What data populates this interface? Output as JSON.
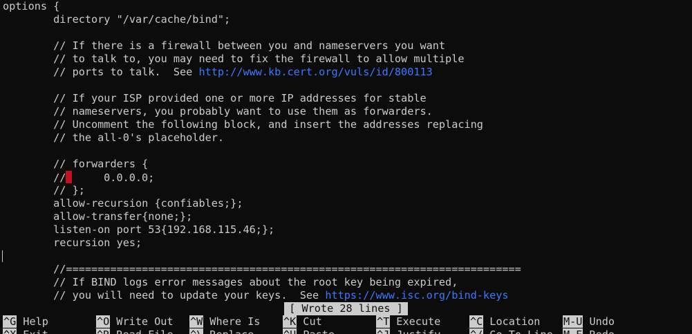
{
  "editor": {
    "lines": [
      "options {",
      "        directory \"/var/cache/bind\";",
      "",
      "        // If there is a firewall between you and nameservers you want",
      "        // to talk to, you may need to fix the firewall to allow multiple",
      "        // ports to talk.  See ",
      "",
      "        // If your ISP provided one or more IP addresses for stable",
      "        // nameservers, you probably want to use them as forwarders.",
      "        // Uncomment the following block, and insert the addresses replacing",
      "        // the all-0's placeholder.",
      "",
      "        // forwarders {",
      "        //",
      "        // };",
      "        allow-recursion {confiables;};",
      "        allow-transfer{none;};",
      "        listen-on port 53{192.168.115.46;};",
      "        recursion yes;",
      "",
      "        //========================================================================",
      "        // If BIND logs error messages about the root key being expired,",
      "        // you will need to update your keys.  See "
    ],
    "url_line_6": "http://www.kb.cert.org/vuls/id/800113",
    "url_line_23": "https://www.isc.org/bind-keys",
    "forwarders_value": "     0.0.0.0;"
  },
  "status": {
    "message": "[ Wrote 28 lines ]"
  },
  "shortcuts": {
    "row1": [
      {
        "key": "^G",
        "label": "Help"
      },
      {
        "key": "^O",
        "label": "Write Out"
      },
      {
        "key": "^W",
        "label": "Where Is"
      },
      {
        "key": "^K",
        "label": "Cut"
      },
      {
        "key": "^T",
        "label": "Execute"
      },
      {
        "key": "^C",
        "label": "Location"
      },
      {
        "key": "M-U",
        "label": "Undo"
      }
    ],
    "row2": [
      {
        "key": "^X",
        "label": "Exit"
      },
      {
        "key": "^R",
        "label": "Read File"
      },
      {
        "key": "^\\",
        "label": "Replace"
      },
      {
        "key": "^U",
        "label": "Paste"
      },
      {
        "key": "^J",
        "label": "Justify"
      },
      {
        "key": "^/",
        "label": "Go To Line"
      },
      {
        "key": "M-E",
        "label": "Redo"
      }
    ]
  },
  "colors": {
    "background": "#0c0c0c",
    "foreground": "#cccccc",
    "url": "#3b78ff",
    "cursor": "#c50f1f"
  }
}
